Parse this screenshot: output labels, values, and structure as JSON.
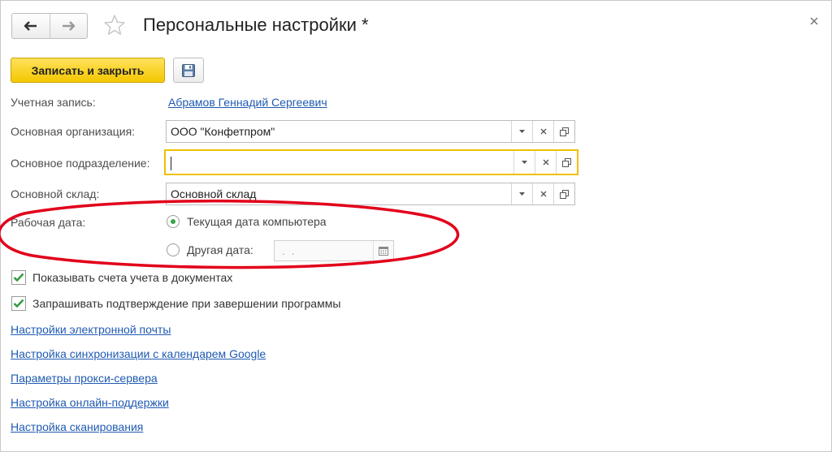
{
  "window": {
    "title": "Персональные настройки *"
  },
  "toolbar": {
    "save_close_label": "Записать и закрыть"
  },
  "form": {
    "account": {
      "label": "Учетная запись:",
      "value": "Абрамов Геннадий Сергеевич"
    },
    "organization": {
      "label": "Основная организация:",
      "value": "ООО \"Конфетпром\""
    },
    "department": {
      "label": "Основное подразделение:",
      "value": ""
    },
    "warehouse": {
      "label": "Основной склад:",
      "value": "Основной склад"
    },
    "work_date": {
      "label": "Рабочая дата:",
      "options": [
        {
          "label": "Текущая дата компьютера",
          "selected": true
        },
        {
          "label": "Другая дата:",
          "selected": false
        }
      ],
      "date_value": ". ."
    },
    "checkboxes": [
      {
        "label": "Показывать счета учета в документах",
        "checked": true
      },
      {
        "label": "Запрашивать подтверждение при завершении программы",
        "checked": true
      }
    ],
    "links": [
      "Настройки электронной почты",
      "Настройка синхронизации с календарем Google",
      "Параметры прокси-сервера",
      "Настройка онлайн-поддержки",
      "Настройка сканирования"
    ]
  },
  "icons": {
    "back": "arrow-left-icon",
    "forward": "arrow-right-icon",
    "favorite": "star-icon",
    "close": "close-icon",
    "save": "floppy-disk-icon",
    "dropdown": "triangle-down-icon",
    "clear": "x-icon",
    "open": "open-window-icon",
    "calendar": "calendar-icon",
    "check": "checkmark-icon"
  },
  "colors": {
    "primary_button": "#f4c700",
    "link": "#1f5ab2",
    "focus_border": "#f0c000",
    "radio_selected": "#3aa547",
    "checkmark": "#2e9b3e",
    "annotation_ellipse": "#e2001a"
  }
}
